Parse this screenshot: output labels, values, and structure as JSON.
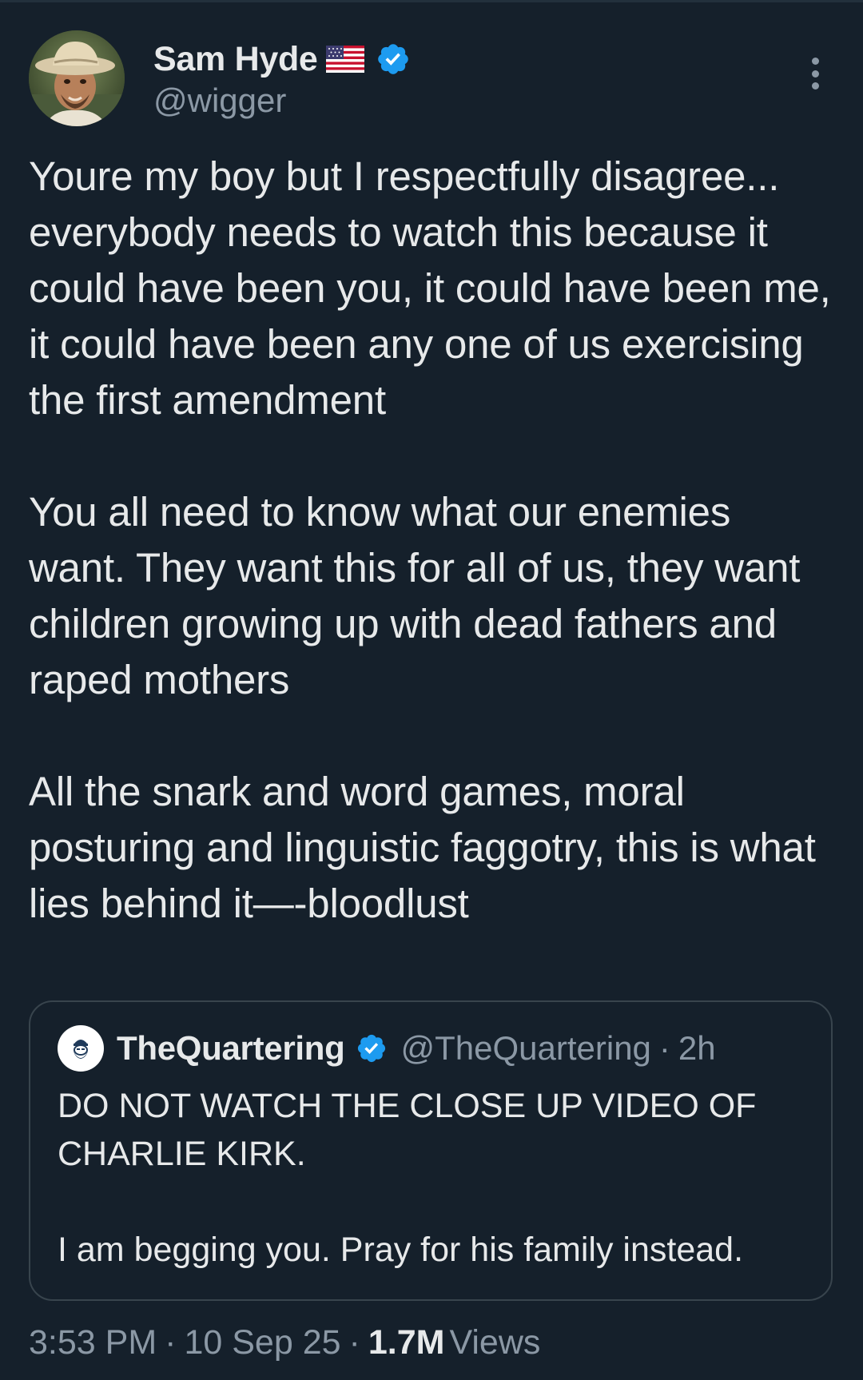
{
  "author": {
    "display_name": "Sam Hyde",
    "handle": "@wigger",
    "flag": "us-flag-icon",
    "verified": true
  },
  "tweet": {
    "paragraphs": [
      "Youre my boy but I respectfully disagree... everybody needs to watch this because it could have been you, it could have been me, it could have been any one of us exercising the first amendment",
      "You all need to know what our enemies want. They want this for all of us, they want children growing up with dead fathers and raped mothers",
      "All the snark and word games, moral posturing and linguistic faggotry, this is what lies behind it—-bloodlust"
    ]
  },
  "quoted_tweet": {
    "display_name": "TheQuartering",
    "handle": "@TheQuartering",
    "separator": "·",
    "time": "2h",
    "verified": true,
    "paragraphs": [
      "DO NOT WATCH THE CLOSE UP VIDEO OF CHARLIE KIRK.",
      "I am begging you.  Pray for his family instead."
    ]
  },
  "meta": {
    "time": "3:53 PM",
    "sep1": "·",
    "date": "10 Sep 25",
    "sep2": "·",
    "views_count": "1.7M",
    "views_label": "Views"
  },
  "colors": {
    "background": "#15202b",
    "text": "#e7e9ea",
    "secondary_text": "#8b98a5",
    "verified_blue": "#1d9bf0",
    "border": "#38444d"
  }
}
